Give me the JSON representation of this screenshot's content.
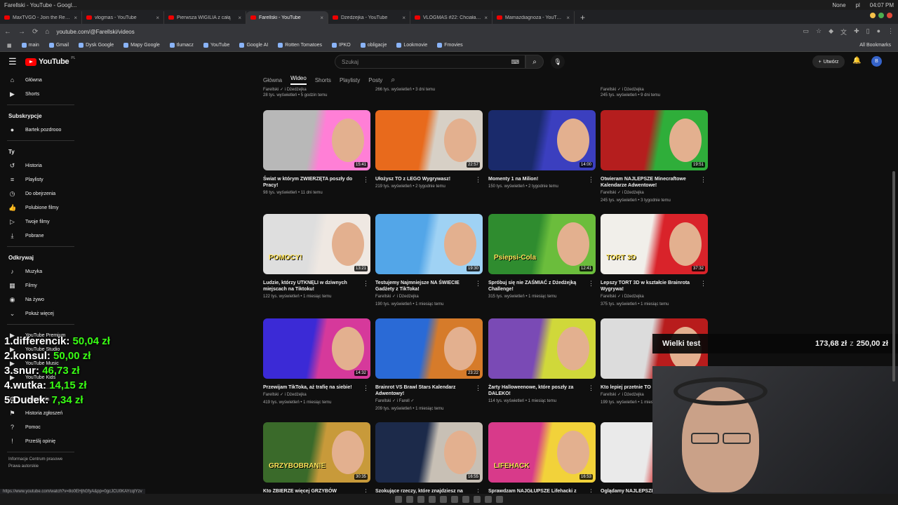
{
  "window": {
    "title": "Farellski - YouTube - Googl...",
    "clock": "04:07 PM",
    "weather": "None",
    "lang": "pl"
  },
  "tabs": [
    {
      "label": "MaxTVGO - Join the Revolu"
    },
    {
      "label": "vlogmas - YouTube"
    },
    {
      "label": "Pierwsza WIGILIA z całą"
    },
    {
      "label": "Farellski - YouTube",
      "active": true
    },
    {
      "label": "Dżedżejka - YouTube"
    },
    {
      "label": "VLOGMAS #22: Chciałam w"
    },
    {
      "label": "Mamazdiagnoza - YouTube"
    }
  ],
  "address": {
    "url": "youtube.com/@Farellski/videos"
  },
  "bookmarks": [
    "main",
    "Gmail",
    "Dysk Google",
    "Mapy Google",
    "tlumacz",
    "YouTube",
    "Google AI",
    "Rotten Tomatoes",
    "IPKO",
    "obligacje",
    "Lookmovie",
    "Fmovies"
  ],
  "bookmarks_all": "All Bookmarks",
  "yt": {
    "logo": "YouTube",
    "region": "PL",
    "search_placeholder": "Szukaj",
    "create": "Utwórz",
    "avatar": "B"
  },
  "sidebar": {
    "top": [
      {
        "label": "Główna",
        "icon": "home-icon"
      },
      {
        "label": "Shorts",
        "icon": "shorts-icon"
      }
    ],
    "subs_header": "Subskrypcje",
    "subs": [
      {
        "label": "Bartek pozdrooo"
      }
    ],
    "you_header": "Ty",
    "you": [
      {
        "label": "Historia"
      },
      {
        "label": "Playlisty"
      },
      {
        "label": "Do obejrzenia"
      },
      {
        "label": "Polubione filmy"
      },
      {
        "label": "Twoje filmy"
      },
      {
        "label": "Pobrane"
      }
    ],
    "explore_header": "Odkrywaj",
    "explore": [
      {
        "label": "Muzyka"
      },
      {
        "label": "Filmy"
      },
      {
        "label": "Na żywo"
      },
      {
        "label": "Pokaż więcej"
      }
    ],
    "more": [
      {
        "label": "YouTube Premium"
      },
      {
        "label": "YouTube Studio"
      },
      {
        "label": "YouTube Music"
      },
      {
        "label": "YouTube Kids"
      }
    ],
    "settings": [
      {
        "label": "Ustawienia"
      },
      {
        "label": "Historia zgłoszeń"
      },
      {
        "label": "Pomoc"
      },
      {
        "label": "Prześlij opinię"
      }
    ],
    "footer": [
      "Informacje  Centrum prasowe",
      "Prawa autorskie"
    ]
  },
  "channel_tabs": [
    "Główna",
    "Wideo",
    "Shorts",
    "Playlisty",
    "Posty"
  ],
  "top_row": [
    {
      "ch": "Farellski  ✓  i Dżedżejka",
      "meta": "28 tys. wyświetleń  •  5 godzin temu"
    },
    {
      "ch": "",
      "meta": "266 tys. wyświetleń  •  3 dni temu"
    },
    {
      "ch": "",
      "meta": ""
    },
    {
      "ch": "Farellski  ✓  i Dżedżejka",
      "meta": "245 tys. wyświetleń  •  9 dni temu"
    }
  ],
  "videos": [
    {
      "title": "Świat w którym ZWIERZĘTA poszły do Pracy!",
      "ch": "",
      "meta": "98 tys. wyświetleń  •  11 dni temu",
      "dur": "15:41",
      "thumb_text": "",
      "colors": [
        "#b8b8b8",
        "#ff7fd6"
      ]
    },
    {
      "title": "Ułożysz TO z LEGO Wygrywasz!",
      "ch": "",
      "meta": "219 tys. wyświetleń  •  2 tygodnie temu",
      "dur": "22:57",
      "thumb_text": "",
      "colors": [
        "#e86a1c",
        "#d7d0c6"
      ]
    },
    {
      "title": "Momenty 1 na Milion!",
      "ch": "",
      "meta": "150 tys. wyświetleń  •  2 tygodnie temu",
      "dur": "14:00",
      "thumb_text": "",
      "colors": [
        "#1a2a6b",
        "#3b3fbf"
      ]
    },
    {
      "title": "Otwieram NAJLEPSZE Minecraftowe Kalendarze Adwentowe!",
      "ch": "Farellski  ✓  i Dżedżejka",
      "meta": "245 tys. wyświetleń  •  3 tygodnie temu",
      "dur": "19:51",
      "thumb_text": "",
      "colors": [
        "#b51e1e",
        "#2fae3a"
      ]
    },
    {
      "title": "Ludzie, którzy UTKNĘLI w dziwnych miejscach na Tiktoku!",
      "ch": "",
      "meta": "122 tys. wyświetleń  •  1 miesiąc temu",
      "dur": "13:21",
      "thumb_text": "POMOCY!",
      "colors": [
        "#dedede",
        "#efe8e2"
      ]
    },
    {
      "title": "Testujemy Najmniejsze NA ŚWIECIE Gadżety z TikToka!",
      "ch": "Farellski  ✓  i Dżedżejka",
      "meta": "190 tys. wyświetleń  •  1 miesiąc temu",
      "dur": "19:30",
      "thumb_text": "",
      "colors": [
        "#53a6e8",
        "#9fd2f4"
      ]
    },
    {
      "title": "Spróbuj się nie ZAŚMIAĆ z Dżedżejką Challenge!",
      "ch": "",
      "meta": "315 tys. wyświetleń  •  1 miesiąc temu",
      "dur": "12:41",
      "thumb_text": "Psiepsi-Cola",
      "colors": [
        "#2f8c2f",
        "#6bbd3c"
      ]
    },
    {
      "title": "Lepszy TORT 3D w kształcie Brainrota Wygrywa!",
      "ch": "Farellski  ✓  i Dżedżejka",
      "meta": "375 tys. wyświetleń  •  1 miesiąc temu",
      "dur": "37:32",
      "thumb_text": "TORT 3D",
      "colors": [
        "#f1efea",
        "#d9232a"
      ]
    },
    {
      "title": "Przewijam TikToka, aż trafię na siebie!",
      "ch": "Farellski  ✓  i Dżedżejka",
      "meta": "419 tys. wyświetleń  •  1 miesiąc temu",
      "dur": "14:32",
      "thumb_text": "",
      "colors": [
        "#3b2ad6",
        "#d6399b"
      ]
    },
    {
      "title": "Brainrot VS Brawl Stars Kalendarz Adwentowy!",
      "ch": "Farellski  ✓  i Farell  ✓",
      "meta": "209 tys. wyświetleń  •  1 miesiąc temu",
      "dur": "23:22",
      "thumb_text": "",
      "colors": [
        "#2a6ad6",
        "#d67b2a"
      ]
    },
    {
      "title": "Żarty Halloweenowe, które poszły za DALEKO!",
      "ch": "",
      "meta": "114 tys. wyświetleń  •  1 miesiąc temu",
      "dur": "",
      "thumb_text": "",
      "colors": [
        "#7a4ab5",
        "#d0d83a"
      ]
    },
    {
      "title": "Kto lepiej przetnie TO na pół Wygrywa!",
      "ch": "Farellski  ✓  i Dżedżejka",
      "meta": "199 tys. wyświetleń  •  1 miesiąc temu",
      "dur": "",
      "thumb_text": "",
      "colors": [
        "#dcdcdc",
        "#b81c1c"
      ]
    },
    {
      "title": "Kto ZBIERZE więcej GRZYBÓW Wygrywa!",
      "ch": "",
      "meta": "",
      "dur": "30:35",
      "thumb_text": "GRZYBOBRANIE",
      "colors": [
        "#3a6a2a",
        "#c89a3a"
      ]
    },
    {
      "title": "Szokujące rzeczy, które znajdziesz na",
      "ch": "",
      "meta": "",
      "dur": "16:55",
      "thumb_text": "",
      "colors": [
        "#1c2a4a",
        "#c8c0b5"
      ]
    },
    {
      "title": "Sprawdzam NAJGŁUPSZE Lifehacki z",
      "ch": "",
      "meta": "",
      "dur": "16:53",
      "thumb_text": "LIFEHACK",
      "colors": [
        "#d83a8a",
        "#f2d23a"
      ]
    },
    {
      "title": "Oglądamy NAJLEPSZE",
      "ch": "",
      "meta": "",
      "dur": "",
      "thumb_text": "",
      "colors": [
        "#eaeaea",
        "#d63a3a"
      ]
    }
  ],
  "overlay": {
    "ranking": [
      {
        "pos": "1.",
        "name": "differencik:",
        "amt": "50,04 zł"
      },
      {
        "pos": "2.",
        "name": "konsul:",
        "amt": "50,00 zł"
      },
      {
        "pos": "3.",
        "name": "snur:",
        "amt": "46,73 zł"
      },
      {
        "pos": "4.",
        "name": "wutka:",
        "amt": "14,15 zł"
      },
      {
        "pos": "5.",
        "name": "Dudek:",
        "amt": "7,34 zł"
      }
    ],
    "goal": {
      "name": "Wielki test",
      "current": "173,68 zł",
      "sep": "z",
      "target": "250,00 zł"
    }
  },
  "status_url": "https://www.youtube.com/watch?v=8o0EHjhGfyA&pp=0gcJCU0KAYcqIYzv"
}
